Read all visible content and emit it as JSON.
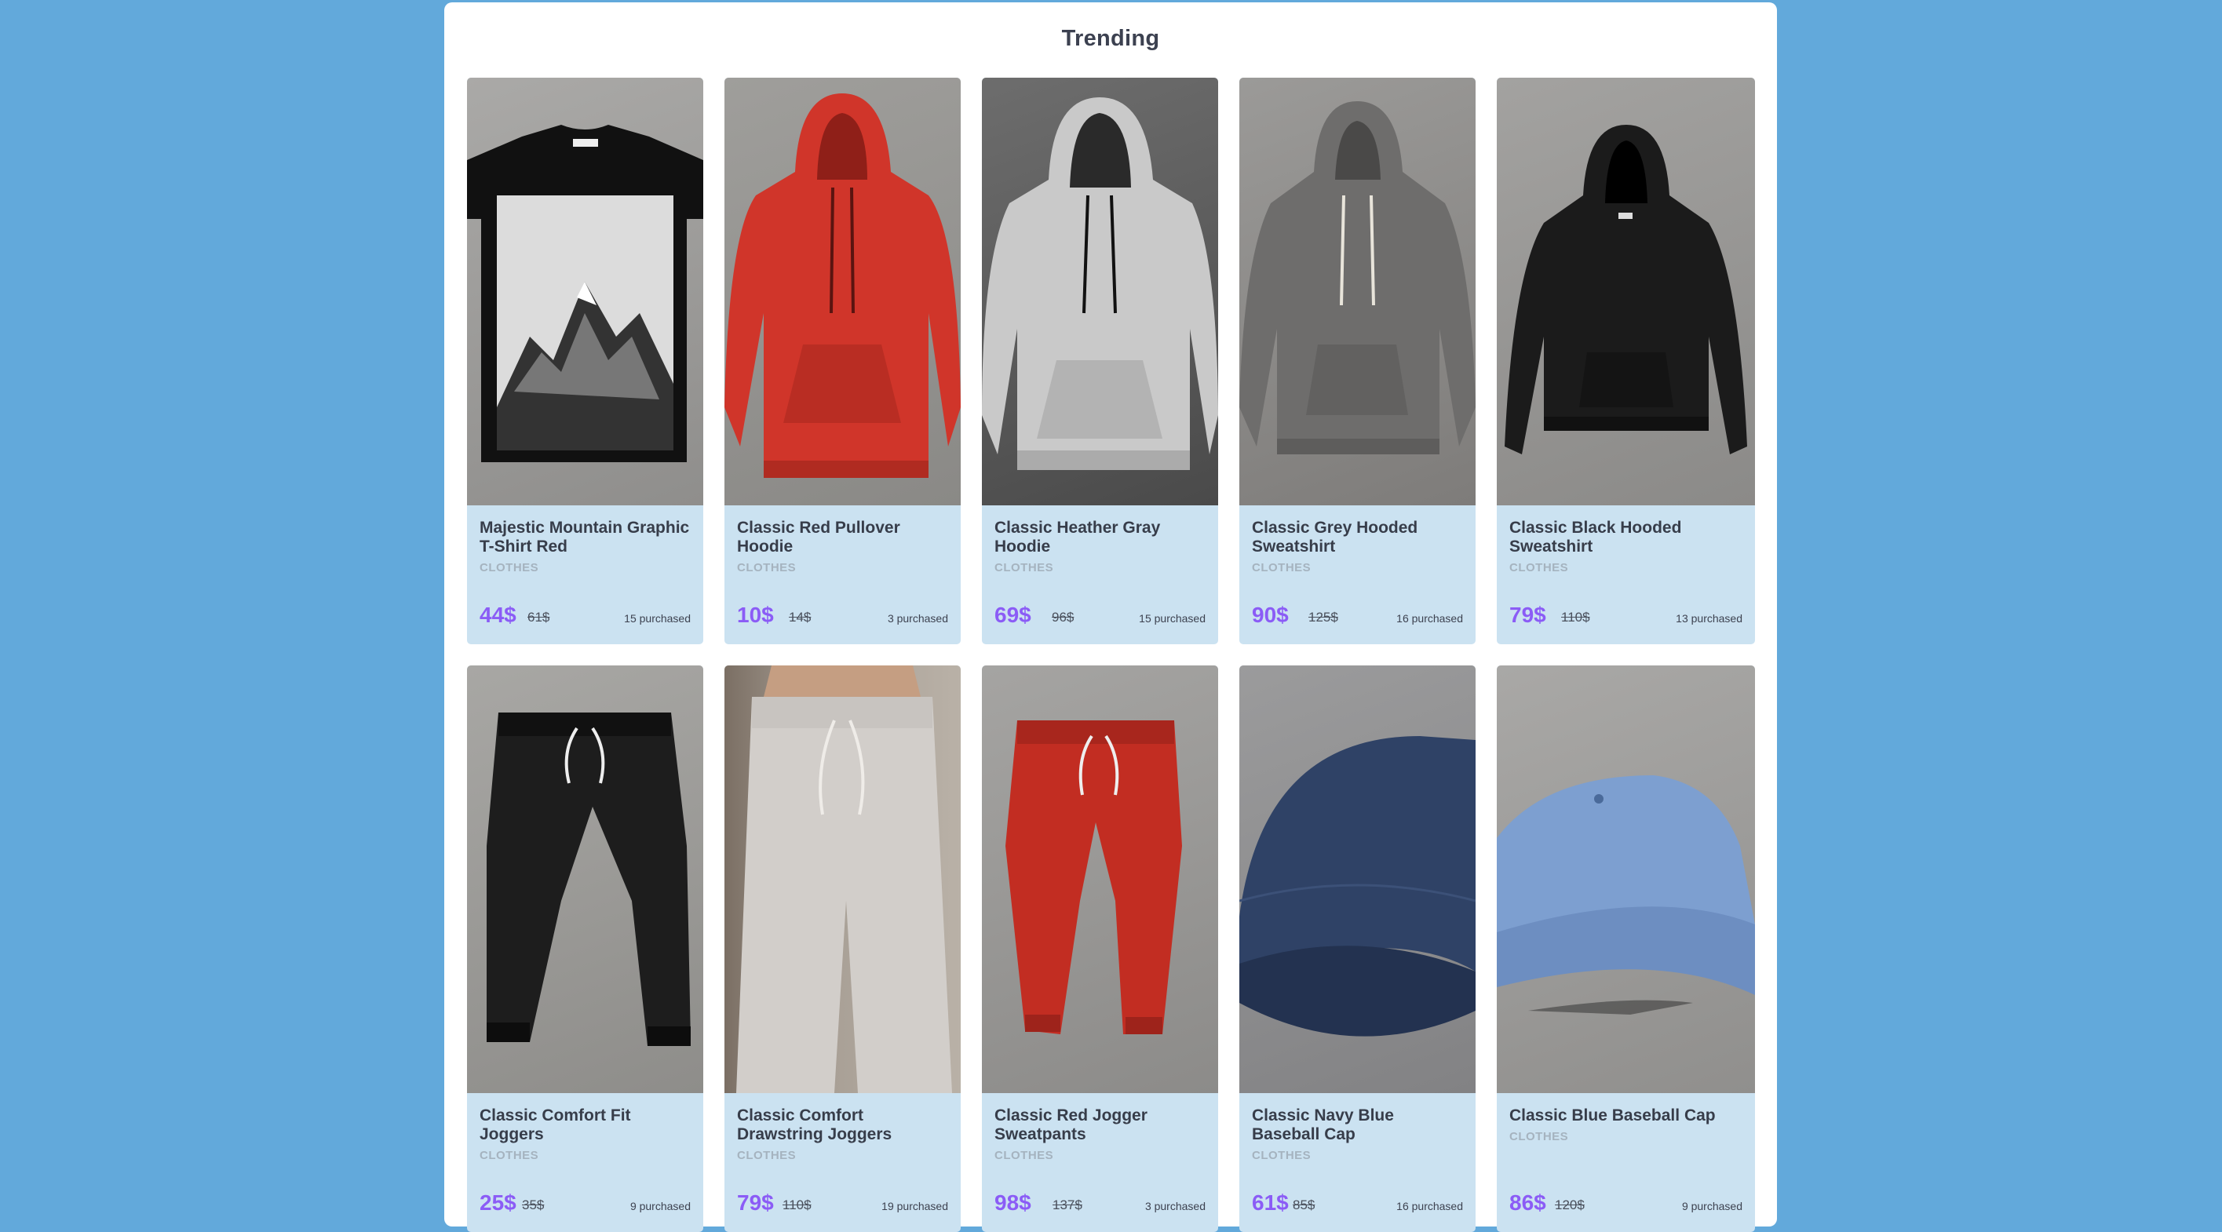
{
  "section": {
    "title": "Trending"
  },
  "colors": {
    "background": "#62a9db",
    "card": "#cbe2f1",
    "price": "#8b5cf6"
  },
  "products": [
    {
      "name": "Majestic Mountain Graphic T-Shirt Red",
      "category": "CLOTHES",
      "price": "44$",
      "old_price": "61$",
      "purchased": "15 purchased",
      "image": "black-mountain-tshirt"
    },
    {
      "name": "Classic Red Pullover Hoodie",
      "category": "CLOTHES",
      "price": "10$",
      "old_price": "14$",
      "purchased": "3 purchased",
      "image": "red-hoodie"
    },
    {
      "name": "Classic Heather Gray Hoodie",
      "category": "CLOTHES",
      "price": "69$",
      "old_price": "96$",
      "purchased": "15 purchased",
      "image": "gray-hoodie"
    },
    {
      "name": "Classic Grey Hooded Sweatshirt",
      "category": "CLOTHES",
      "price": "90$",
      "old_price": "125$",
      "purchased": "16 purchased",
      "image": "grey-hooded-sweatshirt"
    },
    {
      "name": "Classic Black Hooded Sweatshirt",
      "category": "CLOTHES",
      "price": "79$",
      "old_price": "110$",
      "purchased": "13 purchased",
      "image": "black-hooded-sweatshirt"
    },
    {
      "name": "Classic Comfort Fit Joggers",
      "category": "CLOTHES",
      "price": "25$",
      "old_price": "35$",
      "purchased": "9 purchased",
      "image": "black-joggers"
    },
    {
      "name": "Classic Comfort Drawstring Joggers",
      "category": "CLOTHES",
      "price": "79$",
      "old_price": "110$",
      "purchased": "19 purchased",
      "image": "beige-joggers"
    },
    {
      "name": "Classic Red Jogger Sweatpants",
      "category": "CLOTHES",
      "price": "98$",
      "old_price": "137$",
      "purchased": "3 purchased",
      "image": "red-joggers"
    },
    {
      "name": "Classic Navy Blue Baseball Cap",
      "category": "CLOTHES",
      "price": "61$",
      "old_price": "85$",
      "purchased": "16 purchased",
      "image": "navy-cap"
    },
    {
      "name": "Classic Blue Baseball Cap",
      "category": "CLOTHES",
      "price": "86$",
      "old_price": "120$",
      "purchased": "9 purchased",
      "image": "blue-cap"
    }
  ]
}
